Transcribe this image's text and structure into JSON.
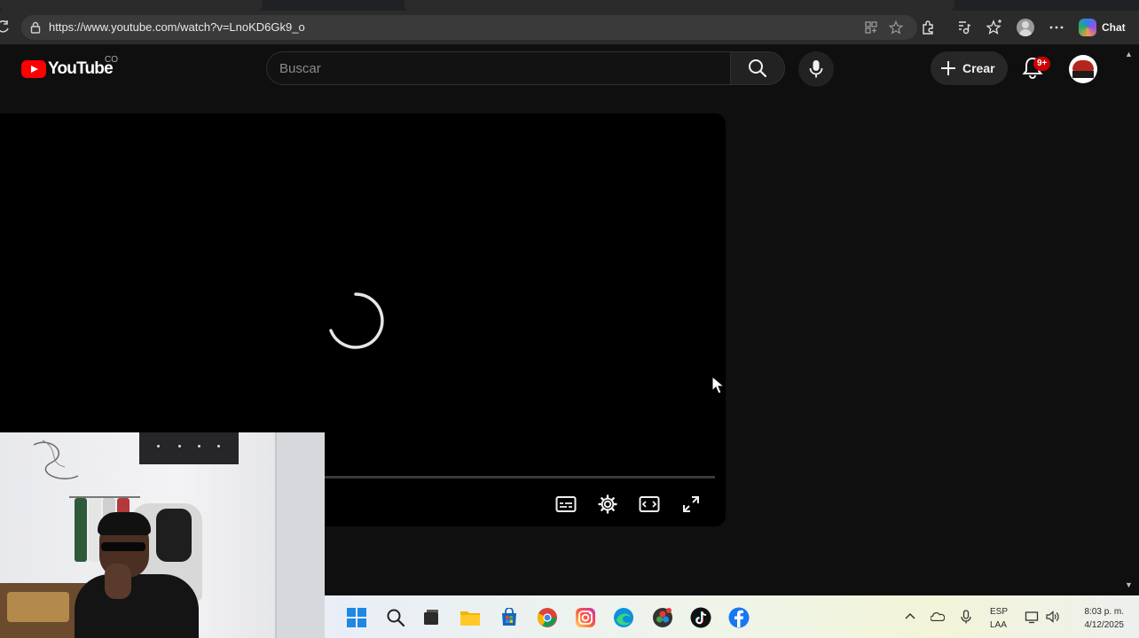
{
  "browser": {
    "url": "https://www.youtube.com/watch?v=LnoKD6Gk9_o",
    "chat_label": "Chat",
    "icons": [
      "reload-icon",
      "lock-icon",
      "app-available-icon",
      "favorite-star-icon",
      "extensions-icon",
      "read-aloud-icon",
      "favorites-icon",
      "profile-icon",
      "more-icon",
      "copilot-icon"
    ]
  },
  "youtube": {
    "logo_text": "YouTube",
    "country_code": "CO",
    "search_placeholder": "Buscar",
    "create_label": "Crear",
    "notification_count": "9+"
  },
  "player": {
    "state": "loading",
    "controls": [
      "subtitles-icon",
      "settings-icon",
      "theater-mode-icon",
      "fullscreen-icon"
    ]
  },
  "taskbar": {
    "apps": [
      "windows-start-icon",
      "search-icon",
      "task-view-icon",
      "file-explorer-icon",
      "microsoft-store-icon",
      "chrome-icon",
      "instagram-icon",
      "edge-icon",
      "davinci-resolve-icon",
      "tiktok-icon",
      "facebook-icon"
    ],
    "lang_line1": "ESP",
    "lang_line2": "LAA",
    "time": "8:03 p. m.",
    "date": "4/12/2025"
  },
  "colors": {
    "youtube_red": "#ff0000",
    "background": "#0f0f0f",
    "loading_bar": "#e64b6b",
    "badge": "#cc0000"
  }
}
